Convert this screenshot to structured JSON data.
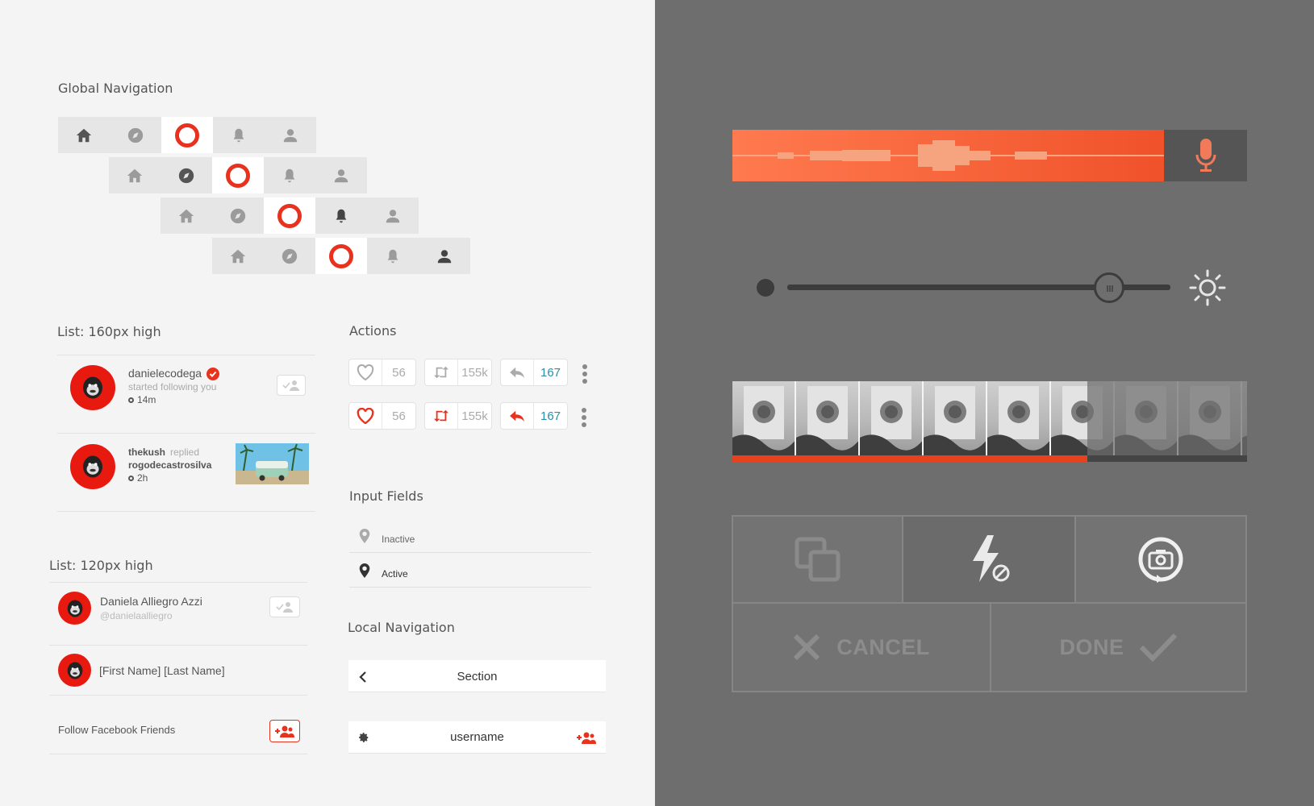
{
  "sections": {
    "global_nav": "Global Navigation",
    "list_160": "List: 160px high",
    "actions": "Actions",
    "input_fields": "Input Fields",
    "list_120": "List: 120px high",
    "local_nav": "Local Navigation"
  },
  "list160": [
    {
      "username": "danielecodega",
      "text": "started following you",
      "time": "14m",
      "verified": true
    },
    {
      "username": "thekush",
      "text": "replied",
      "target": "rogodecastrosilva",
      "time": "2h"
    }
  ],
  "actions": {
    "likes": "56",
    "retweets": "155k",
    "replies": "167"
  },
  "inputs": {
    "inactive_placeholder": "Inactive",
    "active_placeholder": "Active"
  },
  "list120": [
    {
      "name": "Daniela Alliegro Azzi",
      "handle": "@danielaalliegro"
    },
    {
      "name": "[First Name] [Last Name]"
    }
  ],
  "follow_facebook": "Follow Facebook Friends",
  "local_nav": {
    "section_title": "Section",
    "username": "username"
  },
  "camera": {
    "cancel": "CANCEL",
    "done": "DONE"
  },
  "slider": {
    "value": 0.84
  },
  "timeline": {
    "progress": 0.69
  },
  "colors": {
    "accent": "#e8321e",
    "orange": "#ff7a4f",
    "panel": "#6e6e6e",
    "link": "#2a8fa3"
  }
}
